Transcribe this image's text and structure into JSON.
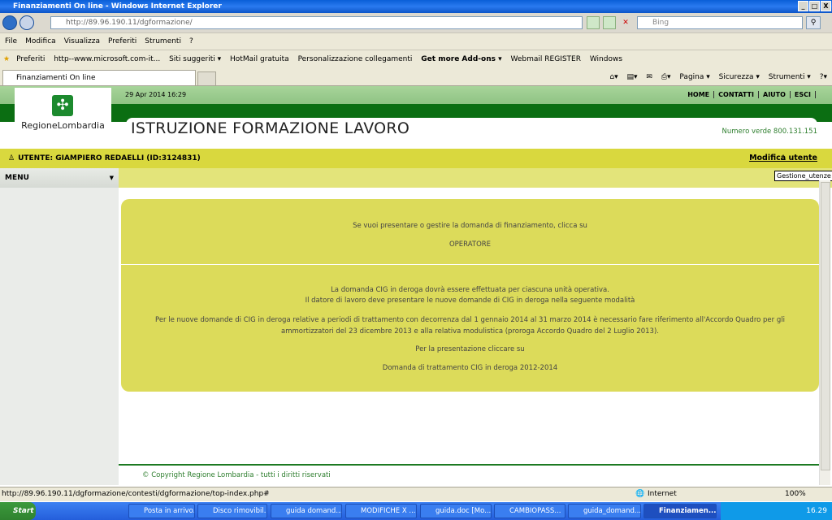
{
  "window": {
    "title": "Finanziamenti On line - Windows Internet Explorer",
    "controls": [
      "_",
      "□",
      "X"
    ]
  },
  "address": {
    "url": "http://89.96.190.11/dgformazione/",
    "search_placeholder": "Bing"
  },
  "menu": [
    "File",
    "Modifica",
    "Visualizza",
    "Preferiti",
    "Strumenti",
    "?"
  ],
  "favorites": {
    "label": "Preferiti",
    "items": [
      "http--www.microsoft.com-it...",
      "Siti suggeriti ▾",
      "HotMail gratuita",
      "Personalizzazione collegamenti",
      "Get more Add-ons ▾",
      "Webmail REGISTER",
      "Windows"
    ]
  },
  "tab": {
    "title": "Finanziamenti On line"
  },
  "commandbar": [
    "Pagina ▾",
    "Sicurezza ▾",
    "Strumenti ▾"
  ],
  "site": {
    "logo_text": "RegioneLombardia",
    "datetime": "29 Apr 2014 16:29",
    "topnav": [
      "HOME",
      "CONTATTI",
      "AIUTO",
      "ESCI"
    ],
    "title": "ISTRUZIONE FORMAZIONE LAVORO",
    "phone": "Numero verde 800.131.151",
    "user": "UTENTE: GIAMPIERO REDAELLI (ID:3124831)",
    "modify_user": "Modifica utente",
    "tooltip": "Gestione_utenze",
    "menu_label": "MENU",
    "box1": {
      "text": "Se vuoi presentare o gestire la domanda di finanziamento, clicca su",
      "link": "OPERATORE"
    },
    "box2": {
      "line1": "La domanda CIG in deroga dovrà essere effettuata per ciascuna unità operativa.",
      "line2": "Il datore di lavoro deve presentare le nuove domande di CIG in deroga nella seguente modalità",
      "para": "Per le nuove domande di CIG in deroga relative a periodi di trattamento con decorrenza dal 1 gennaio 2014 al 31 marzo 2014 è necessario fare riferimento all'Accordo Quadro per gli ammortizzatori del 23 dicembre 2013 e alla relativa modulistica (proroga Accordo Quadro del 2 Luglio 2013).",
      "click": "Per la presentazione cliccare su",
      "link": "Domanda di trattamento CIG in deroga 2012-2014"
    },
    "copyright": "© Copyright Regione Lombardia - tutti i diritti riservati",
    "colors": {
      "green": "#0b6e12",
      "yellow": "#d9d83e",
      "box": "#dcdb5a"
    }
  },
  "statusbar": {
    "url": "http://89.96.190.11/dgformazione/contesti/dgformazione/top-index.php#",
    "zone": "Internet",
    "zoom": "100%"
  },
  "taskbar": {
    "start": "Start",
    "items": [
      "Posta in arrivo...",
      "Disco rimovibil...",
      "guida domand...",
      "MODIFICHE X ...",
      "guida.doc [Mo...",
      "CAMBIOPASS...",
      "guida_domand...",
      "Finanziamen..."
    ],
    "clock": "16.29"
  }
}
